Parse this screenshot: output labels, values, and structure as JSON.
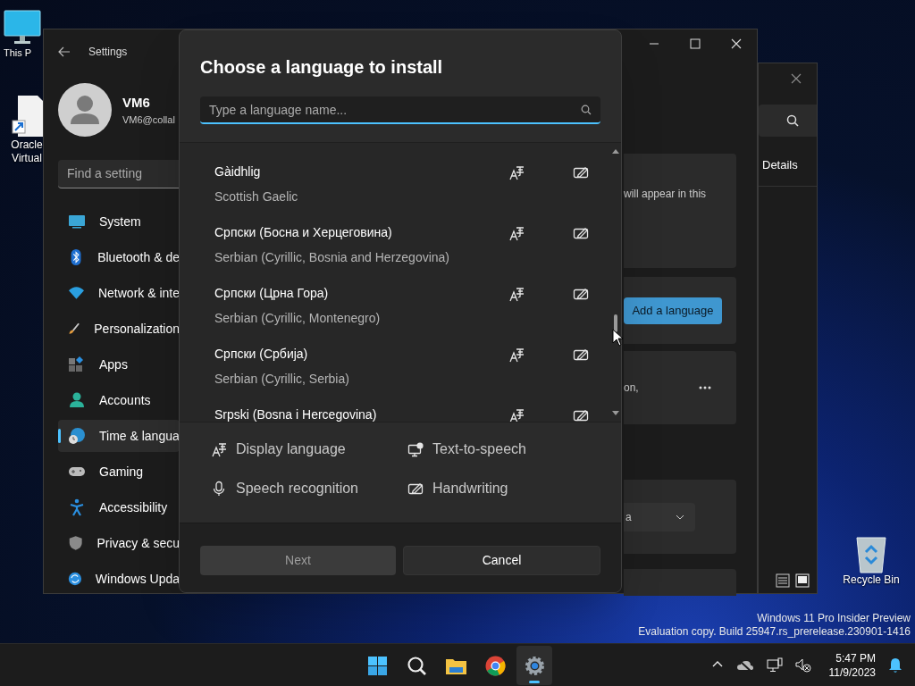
{
  "desktop_icons": [
    {
      "kind": "pc",
      "lines": [
        "This P"
      ]
    },
    {
      "kind": "shortcut",
      "lines": [
        "Oracle",
        "Virtual"
      ]
    },
    {
      "kind": "recycle",
      "lines": [
        "Recycle Bin"
      ]
    }
  ],
  "back_window": {
    "details": "Details"
  },
  "settings_window": {
    "title": "Settings",
    "user": {
      "name": "VM6",
      "email": "VM6@collal"
    },
    "search": {
      "placeholder": "Find a setting"
    },
    "nav": [
      {
        "kind": "system",
        "label": "System",
        "selected": false
      },
      {
        "kind": "bluetooth",
        "label": "Bluetooth & de",
        "selected": false
      },
      {
        "kind": "network",
        "label": "Network & inte",
        "selected": false
      },
      {
        "kind": "personalization",
        "label": "Personalization",
        "selected": false
      },
      {
        "kind": "apps",
        "label": "Apps",
        "selected": false
      },
      {
        "kind": "accounts",
        "label": "Accounts",
        "selected": false
      },
      {
        "kind": "time",
        "label": "Time & langua",
        "selected": true
      },
      {
        "kind": "gaming",
        "label": "Gaming",
        "selected": false
      },
      {
        "kind": "accessibility",
        "label": "Accessibility",
        "selected": false
      },
      {
        "kind": "privacy",
        "label": "Privacy & secu",
        "selected": false
      },
      {
        "kind": "update",
        "label": "Windows Upda",
        "selected": false
      }
    ],
    "content": {
      "note": "will appear in this",
      "add_button": "Add a language",
      "card_text": "on,",
      "dropdown_value": "a"
    }
  },
  "dialog": {
    "title": "Choose a language to install",
    "search": {
      "placeholder": "Type a language name..."
    },
    "languages": [
      {
        "name": "Gàidhlig",
        "english": "Scottish Gaelic",
        "features": [
          {
            "kind": "display"
          },
          {
            "kind": "handwriting"
          }
        ]
      },
      {
        "name": "Српски (Босна и Херцеговина)",
        "english": "Serbian (Cyrillic, Bosnia and Herzegovina)",
        "features": [
          {
            "kind": "display"
          },
          {
            "kind": "handwriting"
          }
        ]
      },
      {
        "name": "Српски (Црна Гора)",
        "english": "Serbian (Cyrillic, Montenegro)",
        "features": [
          {
            "kind": "display"
          },
          {
            "kind": "handwriting"
          }
        ]
      },
      {
        "name": "Српски (Србија)",
        "english": "Serbian (Cyrillic, Serbia)",
        "features": [
          {
            "kind": "display"
          },
          {
            "kind": "handwriting"
          }
        ]
      },
      {
        "name": "Srpski (Bosna i Hercegovina)",
        "features": [
          {
            "kind": "display"
          },
          {
            "kind": "handwriting"
          }
        ]
      }
    ],
    "legend": [
      {
        "kind": "display",
        "label": "Display language"
      },
      {
        "kind": "tts",
        "label": "Text-to-speech"
      },
      {
        "kind": "speech",
        "label": "Speech recognition"
      },
      {
        "kind": "handwriting",
        "label": "Handwriting"
      }
    ],
    "buttons": [
      {
        "label": "Next",
        "disabled": true
      },
      {
        "label": "Cancel",
        "disabled": false
      }
    ]
  },
  "watermark": [
    "Windows 11 Pro Insider Preview",
    "Evaluation copy. Build 25947.rs_prerelease.230901-1416"
  ],
  "taskbar": {
    "apps": [
      {
        "kind": "start",
        "selected": false
      },
      {
        "kind": "search",
        "selected": false
      },
      {
        "kind": "explorer",
        "selected": false
      },
      {
        "kind": "browser",
        "selected": false
      },
      {
        "kind": "settings",
        "selected": true
      }
    ],
    "tray": [
      {
        "kind": "chevron"
      },
      {
        "kind": "cloud"
      },
      {
        "kind": "network"
      },
      {
        "kind": "volume"
      }
    ],
    "time": "5:47 PM",
    "date": "11/9/2023"
  }
}
